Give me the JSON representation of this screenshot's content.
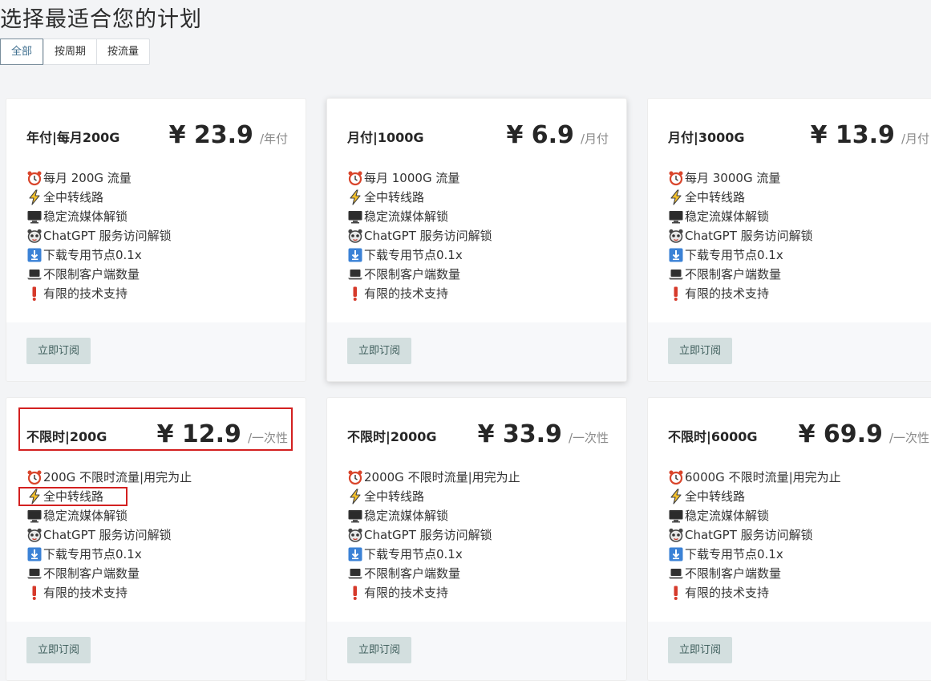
{
  "page_title": "选择最适合您的计划",
  "tabs": [
    {
      "label": "全部",
      "active": true
    },
    {
      "label": "按周期",
      "active": false
    },
    {
      "label": "按流量",
      "active": false
    }
  ],
  "plans": [
    {
      "name": "年付|每月200G",
      "price": "¥ 23.9",
      "period": "/年付",
      "features": [
        {
          "icon": "alarm-clock-icon",
          "text": "每月 200G 流量"
        },
        {
          "icon": "lightning-icon",
          "text": "全中转线路"
        },
        {
          "icon": "monitor-icon",
          "text": "稳定流媒体解锁"
        },
        {
          "icon": "bear-icon",
          "text": "ChatGPT 服务访问解锁"
        },
        {
          "icon": "download-arrow-icon",
          "text": "下载专用节点0.1x"
        },
        {
          "icon": "laptop-icon",
          "text": "不限制客户端数量"
        },
        {
          "icon": "exclamation-icon",
          "text": "有限的技术支持"
        }
      ],
      "button": "立即订阅"
    },
    {
      "name": "月付|1000G",
      "price": "¥ 6.9",
      "period": "/月付",
      "features": [
        {
          "icon": "alarm-clock-icon",
          "text": "每月 1000G 流量"
        },
        {
          "icon": "lightning-icon",
          "text": "全中转线路"
        },
        {
          "icon": "monitor-icon",
          "text": "稳定流媒体解锁"
        },
        {
          "icon": "bear-icon",
          "text": "ChatGPT 服务访问解锁"
        },
        {
          "icon": "download-arrow-icon",
          "text": "下载专用节点0.1x"
        },
        {
          "icon": "laptop-icon",
          "text": "不限制客户端数量"
        },
        {
          "icon": "exclamation-icon",
          "text": "有限的技术支持"
        }
      ],
      "button": "立即订阅"
    },
    {
      "name": "月付|3000G",
      "price": "¥ 13.9",
      "period": "/月付",
      "features": [
        {
          "icon": "alarm-clock-icon",
          "text": "每月 3000G 流量"
        },
        {
          "icon": "lightning-icon",
          "text": "全中转线路"
        },
        {
          "icon": "monitor-icon",
          "text": "稳定流媒体解锁"
        },
        {
          "icon": "bear-icon",
          "text": "ChatGPT 服务访问解锁"
        },
        {
          "icon": "download-arrow-icon",
          "text": "下载专用节点0.1x"
        },
        {
          "icon": "laptop-icon",
          "text": "不限制客户端数量"
        },
        {
          "icon": "exclamation-icon",
          "text": "有限的技术支持"
        }
      ],
      "button": "立即订阅"
    },
    {
      "name": "不限时|200G",
      "price": "¥ 12.9",
      "period": "/一次性",
      "features": [
        {
          "icon": "alarm-clock-icon",
          "text": "200G 不限时流量|用完为止"
        },
        {
          "icon": "lightning-icon",
          "text": "全中转线路"
        },
        {
          "icon": "monitor-icon",
          "text": "稳定流媒体解锁"
        },
        {
          "icon": "bear-icon",
          "text": "ChatGPT 服务访问解锁"
        },
        {
          "icon": "download-arrow-icon",
          "text": "下载专用节点0.1x"
        },
        {
          "icon": "laptop-icon",
          "text": "不限制客户端数量"
        },
        {
          "icon": "exclamation-icon",
          "text": "有限的技术支持"
        }
      ],
      "button": "立即订阅"
    },
    {
      "name": "不限时|2000G",
      "price": "¥ 33.9",
      "period": "/一次性",
      "features": [
        {
          "icon": "alarm-clock-icon",
          "text": "2000G 不限时流量|用完为止"
        },
        {
          "icon": "lightning-icon",
          "text": "全中转线路"
        },
        {
          "icon": "monitor-icon",
          "text": "稳定流媒体解锁"
        },
        {
          "icon": "bear-icon",
          "text": "ChatGPT 服务访问解锁"
        },
        {
          "icon": "download-arrow-icon",
          "text": "下载专用节点0.1x"
        },
        {
          "icon": "laptop-icon",
          "text": "不限制客户端数量"
        },
        {
          "icon": "exclamation-icon",
          "text": "有限的技术支持"
        }
      ],
      "button": "立即订阅"
    },
    {
      "name": "不限时|6000G",
      "price": "¥ 69.9",
      "period": "/一次性",
      "features": [
        {
          "icon": "alarm-clock-icon",
          "text": "6000G 不限时流量|用完为止"
        },
        {
          "icon": "lightning-icon",
          "text": "全中转线路"
        },
        {
          "icon": "monitor-icon",
          "text": "稳定流媒体解锁"
        },
        {
          "icon": "bear-icon",
          "text": "ChatGPT 服务访问解锁"
        },
        {
          "icon": "download-arrow-icon",
          "text": "下载专用节点0.1x"
        },
        {
          "icon": "laptop-icon",
          "text": "不限制客户端数量"
        },
        {
          "icon": "exclamation-icon",
          "text": "有限的技术支持"
        }
      ],
      "button": "立即订阅"
    }
  ],
  "colors": {
    "highlight_box": "#d32020",
    "button_bg": "#d3dfdf",
    "button_text": "#42615f"
  }
}
